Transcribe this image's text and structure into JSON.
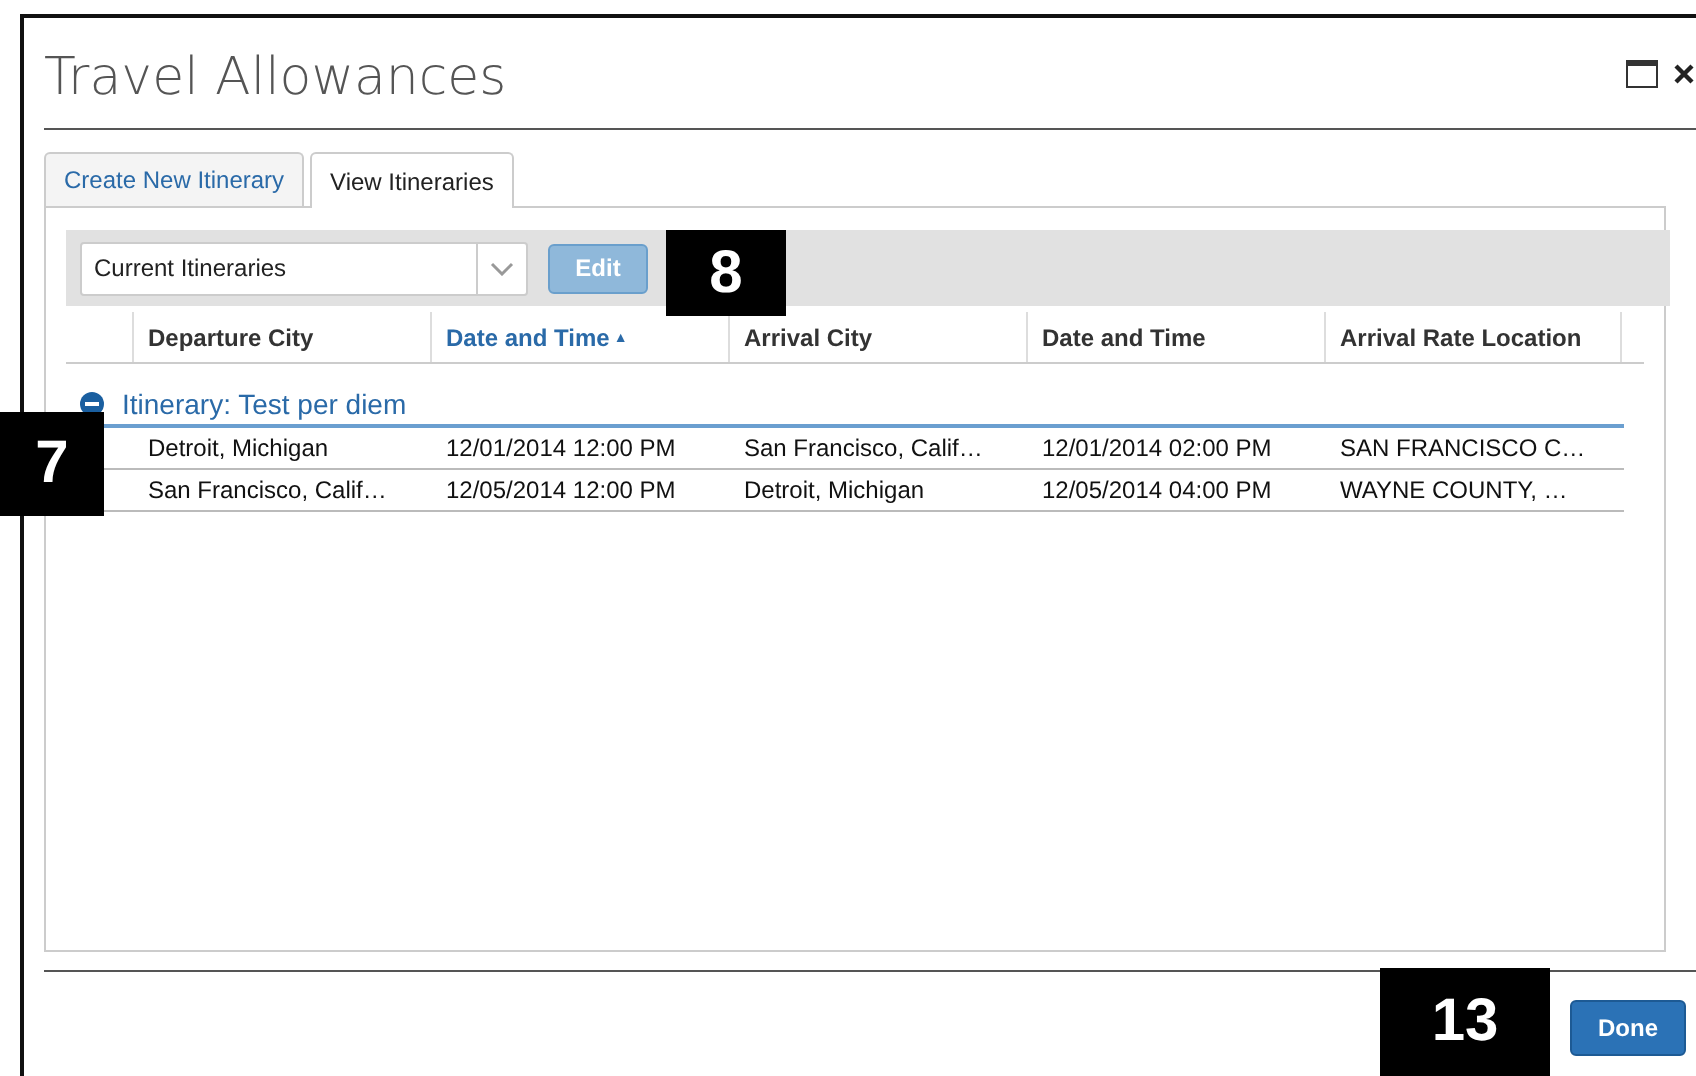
{
  "window": {
    "title": "Travel Allowances"
  },
  "tabs": [
    {
      "label": "Create New Itinerary",
      "selected": false
    },
    {
      "label": "View Itineraries",
      "selected": true
    }
  ],
  "toolbar": {
    "filter": {
      "value": "Current Itineraries"
    },
    "buttons": [
      {
        "label": "Edit",
        "disabled": true
      }
    ]
  },
  "table": {
    "columns": [
      {
        "label": "Departure City",
        "sorted": false
      },
      {
        "label": "Date and Time",
        "sorted": true,
        "sort_indicator": "▲"
      },
      {
        "label": "Arrival City",
        "sorted": false
      },
      {
        "label": "Date and Time",
        "sorted": false
      },
      {
        "label": "Arrival Rate Location",
        "sorted": false
      }
    ],
    "groups": [
      {
        "label": "Itinerary: Test per diem",
        "expanded": true,
        "rows": [
          [
            "Detroit, Michigan",
            "12/01/2014 12:00 PM",
            "San Francisco, Calif…",
            "12/01/2014 02:00 PM",
            "SAN FRANCISCO C…"
          ],
          [
            "San Francisco, Calif…",
            "12/05/2014 12:00 PM",
            "Detroit, Michigan",
            "12/05/2014 04:00 PM",
            "WAYNE COUNTY, …"
          ]
        ]
      }
    ]
  },
  "footer": {
    "buttons": [
      "Done"
    ]
  },
  "callouts": [
    "8",
    "7",
    "13"
  ]
}
